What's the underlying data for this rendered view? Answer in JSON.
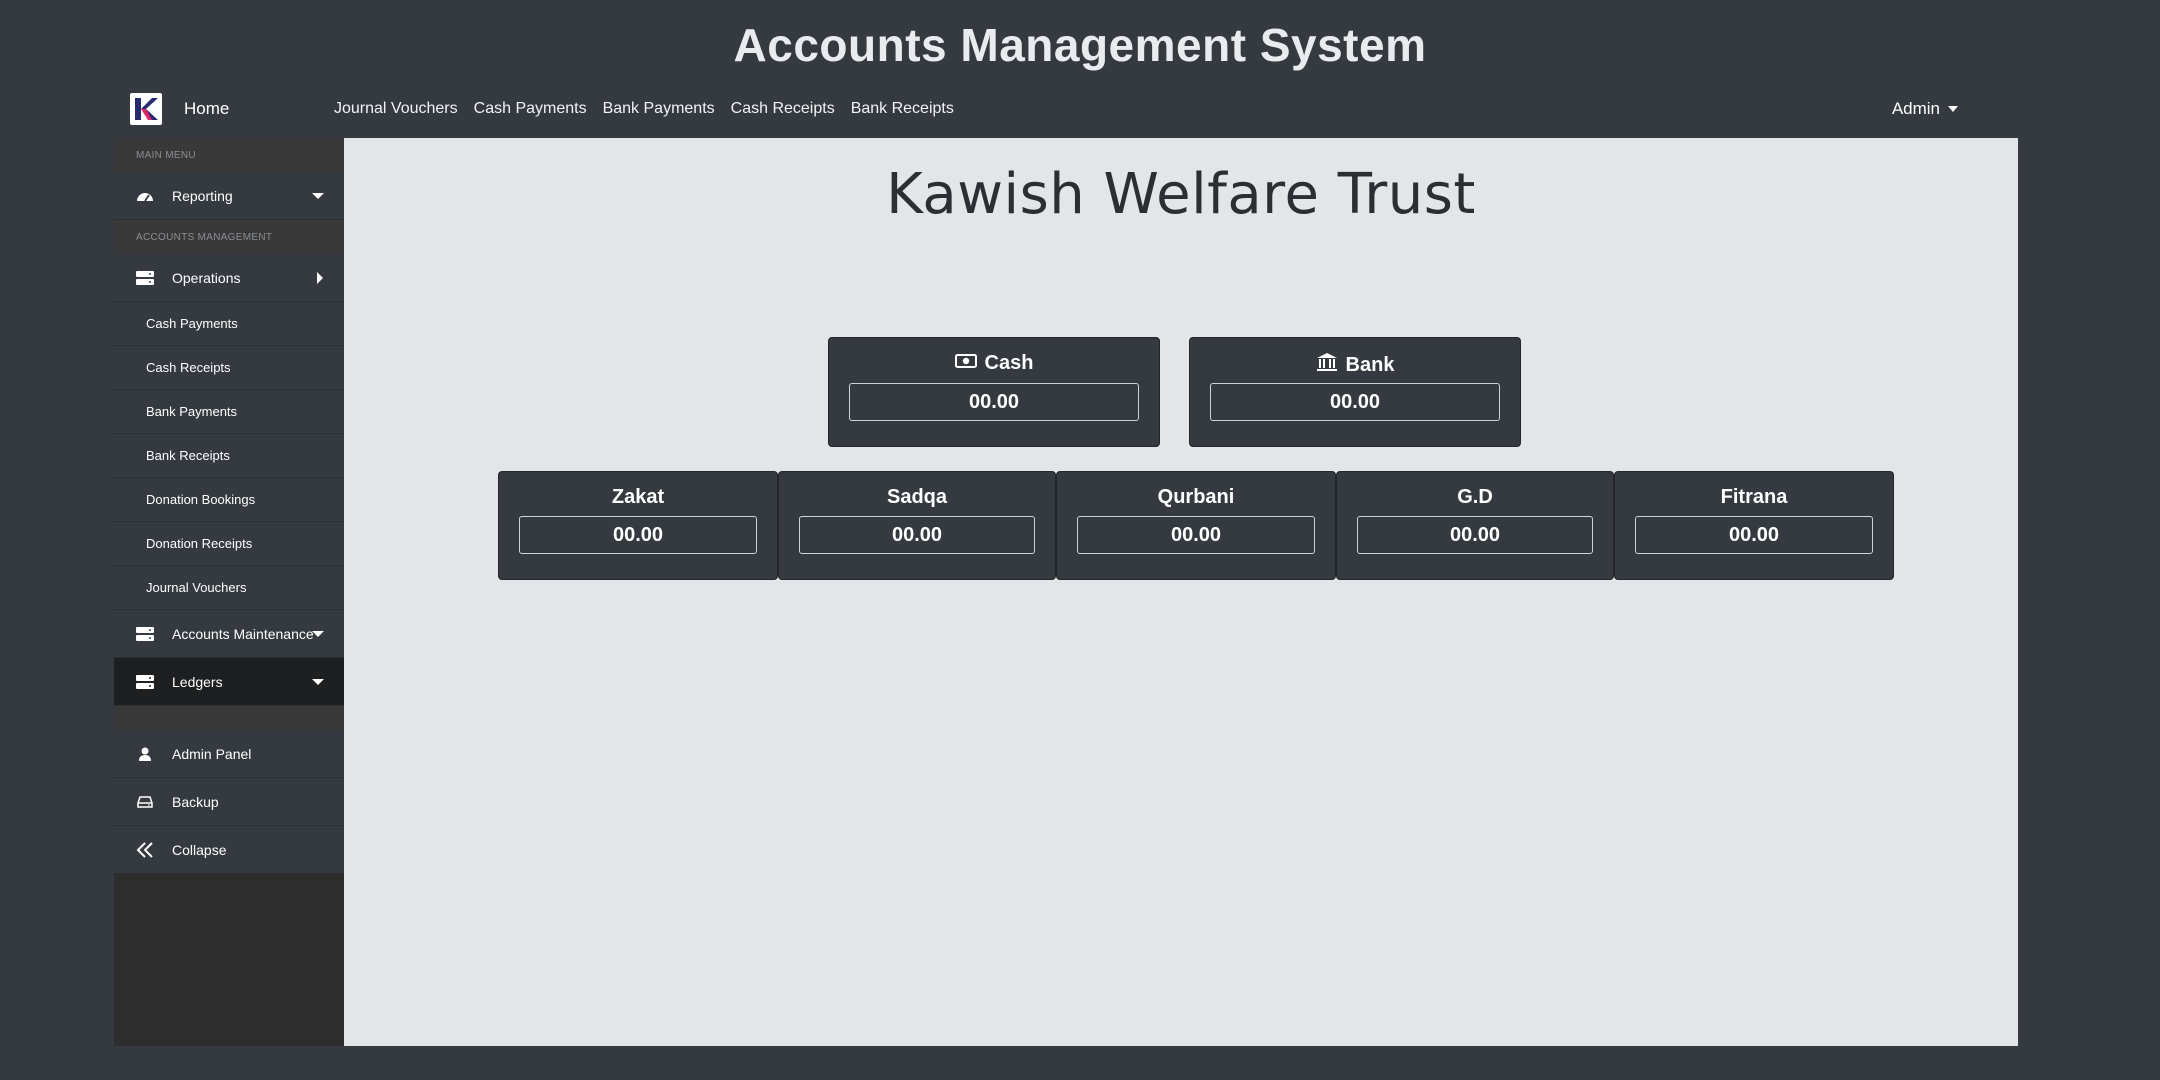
{
  "app": {
    "title": "Accounts Management System"
  },
  "topnav": {
    "home": "Home",
    "links": [
      "Journal Vouchers",
      "Cash Payments",
      "Bank Payments",
      "Cash Receipts",
      "Bank Receipts"
    ],
    "user": "Admin"
  },
  "sidebar": {
    "main_menu_heading": "MAIN MENU",
    "reporting": "Reporting",
    "accounts_heading": "ACCOUNTS MANAGEMENT",
    "operations": "Operations",
    "operations_items": [
      "Cash Payments",
      "Cash Receipts",
      "Bank Payments",
      "Bank Receipts",
      "Donation Bookings",
      "Donation Receipts",
      "Journal Vouchers"
    ],
    "accounts_maintenance": "Accounts Maintenance",
    "ledgers": "Ledgers",
    "admin_panel": "Admin Panel",
    "backup": "Backup",
    "collapse": "Collapse"
  },
  "main": {
    "org_name": "Kawish Welfare Trust",
    "balances": [
      {
        "label": "Cash",
        "value": "00.00"
      },
      {
        "label": "Bank",
        "value": "00.00"
      }
    ],
    "funds": [
      {
        "label": "Zakat",
        "value": "00.00"
      },
      {
        "label": "Sadqa",
        "value": "00.00"
      },
      {
        "label": "Qurbani",
        "value": "00.00"
      },
      {
        "label": "G.D",
        "value": "00.00"
      },
      {
        "label": "Fitrana",
        "value": "00.00"
      }
    ]
  }
}
